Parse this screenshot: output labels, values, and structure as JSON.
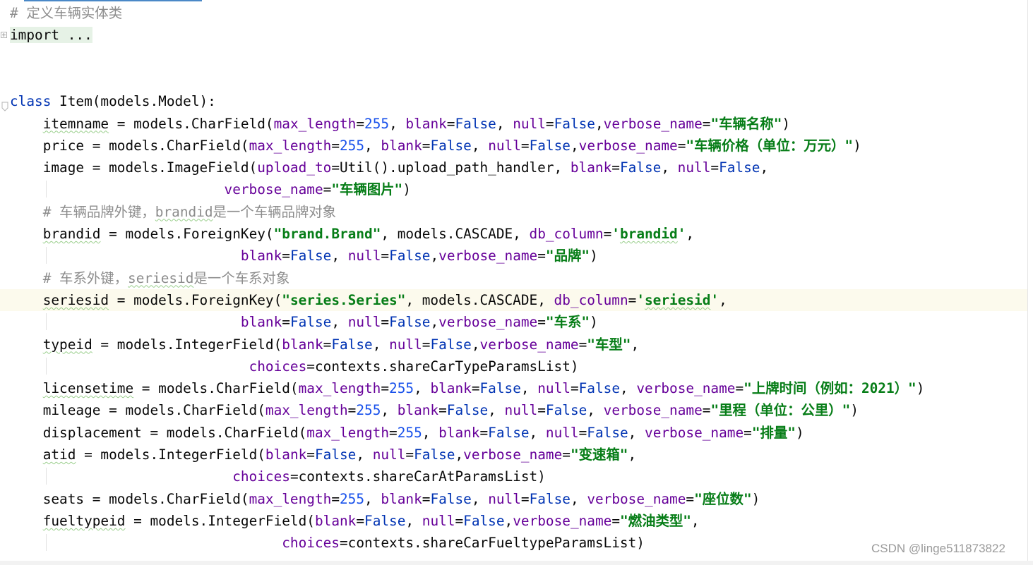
{
  "editor": {
    "lines": [
      {
        "tokens": [
          {
            "t": "# 定义车辆实体类",
            "c": "cm"
          }
        ]
      },
      {
        "fold": "collapsed",
        "tokens": [
          {
            "t": "import ...",
            "c": "folded"
          }
        ]
      },
      {
        "tokens": []
      },
      {
        "tokens": []
      },
      {
        "fold": "end",
        "tokens": [
          {
            "t": "class",
            "c": "kw"
          },
          {
            "t": " Item(models.Model):",
            "c": "id"
          }
        ]
      },
      {
        "tokens": [
          {
            "t": "    "
          },
          {
            "t": "itemname",
            "c": "id",
            "sq": true
          },
          {
            "t": " = models.CharField(",
            "c": "id"
          },
          {
            "t": "max_length",
            "c": "kwarg"
          },
          {
            "t": "=",
            "c": "id"
          },
          {
            "t": "255",
            "c": "num"
          },
          {
            "t": ", ",
            "c": "id"
          },
          {
            "t": "blank",
            "c": "kwarg"
          },
          {
            "t": "=",
            "c": "id"
          },
          {
            "t": "False",
            "c": "kw"
          },
          {
            "t": ", ",
            "c": "id"
          },
          {
            "t": "null",
            "c": "kwarg"
          },
          {
            "t": "=",
            "c": "id"
          },
          {
            "t": "False",
            "c": "kw"
          },
          {
            "t": ",",
            "c": "id"
          },
          {
            "t": "verbose_name",
            "c": "kwarg"
          },
          {
            "t": "=",
            "c": "id"
          },
          {
            "t": "\"车辆名称\"",
            "c": "str"
          },
          {
            "t": ")",
            "c": "id"
          }
        ]
      },
      {
        "tokens": [
          {
            "t": "    price = models.CharField(",
            "c": "id"
          },
          {
            "t": "max_length",
            "c": "kwarg"
          },
          {
            "t": "=",
            "c": "id"
          },
          {
            "t": "255",
            "c": "num"
          },
          {
            "t": ", ",
            "c": "id"
          },
          {
            "t": "blank",
            "c": "kwarg"
          },
          {
            "t": "=",
            "c": "id"
          },
          {
            "t": "False",
            "c": "kw"
          },
          {
            "t": ", ",
            "c": "id"
          },
          {
            "t": "null",
            "c": "kwarg"
          },
          {
            "t": "=",
            "c": "id"
          },
          {
            "t": "False",
            "c": "kw"
          },
          {
            "t": ",",
            "c": "id"
          },
          {
            "t": "verbose_name",
            "c": "kwarg"
          },
          {
            "t": "=",
            "c": "id"
          },
          {
            "t": "\"车辆价格（单位：万元）\"",
            "c": "str"
          },
          {
            "t": ")",
            "c": "id"
          }
        ]
      },
      {
        "tokens": [
          {
            "t": "    image = models.ImageField(",
            "c": "id"
          },
          {
            "t": "upload_to",
            "c": "kwarg"
          },
          {
            "t": "=Util().upload_path_handler, ",
            "c": "id"
          },
          {
            "t": "blank",
            "c": "kwarg"
          },
          {
            "t": "=",
            "c": "id"
          },
          {
            "t": "False",
            "c": "kw"
          },
          {
            "t": ", ",
            "c": "id"
          },
          {
            "t": "null",
            "c": "kwarg"
          },
          {
            "t": "=",
            "c": "id"
          },
          {
            "t": "False",
            "c": "kw"
          },
          {
            "t": ",",
            "c": "id"
          }
        ]
      },
      {
        "guide": true,
        "tokens": [
          {
            "t": "                          "
          },
          {
            "t": "verbose_name",
            "c": "kwarg"
          },
          {
            "t": "=",
            "c": "id"
          },
          {
            "t": "\"车辆图片\"",
            "c": "str"
          },
          {
            "t": ")",
            "c": "id"
          }
        ]
      },
      {
        "tokens": [
          {
            "t": "    "
          },
          {
            "t": "# 车辆品牌外键，",
            "c": "cm"
          },
          {
            "t": "brandid",
            "c": "cm",
            "sq": true
          },
          {
            "t": "是一个车辆品牌对象",
            "c": "cm"
          }
        ]
      },
      {
        "tokens": [
          {
            "t": "    "
          },
          {
            "t": "brandid",
            "c": "id",
            "sq": true
          },
          {
            "t": " = models.ForeignKey(",
            "c": "id"
          },
          {
            "t": "\"brand.Brand\"",
            "c": "str"
          },
          {
            "t": ", models.CASCADE, ",
            "c": "id"
          },
          {
            "t": "db_column",
            "c": "kwarg"
          },
          {
            "t": "=",
            "c": "id"
          },
          {
            "t": "'",
            "c": "str"
          },
          {
            "t": "brandid",
            "c": "str",
            "sq": true
          },
          {
            "t": "'",
            "c": "str"
          },
          {
            "t": ",",
            "c": "id"
          }
        ]
      },
      {
        "guide": true,
        "tokens": [
          {
            "t": "                            "
          },
          {
            "t": "blank",
            "c": "kwarg"
          },
          {
            "t": "=",
            "c": "id"
          },
          {
            "t": "False",
            "c": "kw"
          },
          {
            "t": ", ",
            "c": "id"
          },
          {
            "t": "null",
            "c": "kwarg"
          },
          {
            "t": "=",
            "c": "id"
          },
          {
            "t": "False",
            "c": "kw"
          },
          {
            "t": ",",
            "c": "id"
          },
          {
            "t": "verbose_name",
            "c": "kwarg"
          },
          {
            "t": "=",
            "c": "id"
          },
          {
            "t": "\"品牌\"",
            "c": "str"
          },
          {
            "t": ")",
            "c": "id"
          }
        ]
      },
      {
        "tokens": [
          {
            "t": "    "
          },
          {
            "t": "# 车系外键，",
            "c": "cm"
          },
          {
            "t": "seriesid",
            "c": "cm",
            "sq": true
          },
          {
            "t": "是一个车系对象",
            "c": "cm"
          }
        ]
      },
      {
        "current": true,
        "tokens": [
          {
            "t": "    "
          },
          {
            "t": "seriesid",
            "c": "id",
            "sq": true
          },
          {
            "t": " = models.ForeignKey(",
            "c": "id"
          },
          {
            "t": "\"series.Series\"",
            "c": "str"
          },
          {
            "t": ", models.CASCADE, ",
            "c": "id"
          },
          {
            "t": "db_column",
            "c": "kwarg"
          },
          {
            "t": "=",
            "c": "id"
          },
          {
            "t": "'",
            "c": "str"
          },
          {
            "t": "seriesid",
            "c": "str",
            "sq": true
          },
          {
            "t": "'",
            "c": "str"
          },
          {
            "t": ",",
            "c": "id"
          }
        ]
      },
      {
        "guide": true,
        "tokens": [
          {
            "t": "                            "
          },
          {
            "t": "blank",
            "c": "kwarg"
          },
          {
            "t": "=",
            "c": "id"
          },
          {
            "t": "False",
            "c": "kw"
          },
          {
            "t": ", ",
            "c": "id"
          },
          {
            "t": "null",
            "c": "kwarg"
          },
          {
            "t": "=",
            "c": "id"
          },
          {
            "t": "False",
            "c": "kw"
          },
          {
            "t": ",",
            "c": "id"
          },
          {
            "t": "verbose_name",
            "c": "kwarg"
          },
          {
            "t": "=",
            "c": "id"
          },
          {
            "t": "\"车系\"",
            "c": "str"
          },
          {
            "t": ")",
            "c": "id"
          }
        ]
      },
      {
        "tokens": [
          {
            "t": "    "
          },
          {
            "t": "typeid",
            "c": "id",
            "sq": true
          },
          {
            "t": " = models.IntegerField(",
            "c": "id"
          },
          {
            "t": "blank",
            "c": "kwarg"
          },
          {
            "t": "=",
            "c": "id"
          },
          {
            "t": "False",
            "c": "kw"
          },
          {
            "t": ", ",
            "c": "id"
          },
          {
            "t": "null",
            "c": "kwarg"
          },
          {
            "t": "=",
            "c": "id"
          },
          {
            "t": "False",
            "c": "kw"
          },
          {
            "t": ",",
            "c": "id"
          },
          {
            "t": "verbose_name",
            "c": "kwarg"
          },
          {
            "t": "=",
            "c": "id"
          },
          {
            "t": "\"车型\"",
            "c": "str"
          },
          {
            "t": ",",
            "c": "id"
          }
        ]
      },
      {
        "guide": true,
        "tokens": [
          {
            "t": "                             "
          },
          {
            "t": "choices",
            "c": "kwarg"
          },
          {
            "t": "=contexts.shareCarTypeParamsList)",
            "c": "id"
          }
        ]
      },
      {
        "tokens": [
          {
            "t": "    "
          },
          {
            "t": "licensetime",
            "c": "id",
            "sq": true
          },
          {
            "t": " = models.CharField(",
            "c": "id"
          },
          {
            "t": "max_length",
            "c": "kwarg"
          },
          {
            "t": "=",
            "c": "id"
          },
          {
            "t": "255",
            "c": "num"
          },
          {
            "t": ", ",
            "c": "id"
          },
          {
            "t": "blank",
            "c": "kwarg"
          },
          {
            "t": "=",
            "c": "id"
          },
          {
            "t": "False",
            "c": "kw"
          },
          {
            "t": ", ",
            "c": "id"
          },
          {
            "t": "null",
            "c": "kwarg"
          },
          {
            "t": "=",
            "c": "id"
          },
          {
            "t": "False",
            "c": "kw"
          },
          {
            "t": ", ",
            "c": "id"
          },
          {
            "t": "verbose_name",
            "c": "kwarg"
          },
          {
            "t": "=",
            "c": "id"
          },
          {
            "t": "\"上牌时间（例如：2021）\"",
            "c": "str"
          },
          {
            "t": ")",
            "c": "id"
          }
        ]
      },
      {
        "tokens": [
          {
            "t": "    mileage = models.CharField(",
            "c": "id"
          },
          {
            "t": "max_length",
            "c": "kwarg"
          },
          {
            "t": "=",
            "c": "id"
          },
          {
            "t": "255",
            "c": "num"
          },
          {
            "t": ", ",
            "c": "id"
          },
          {
            "t": "blank",
            "c": "kwarg"
          },
          {
            "t": "=",
            "c": "id"
          },
          {
            "t": "False",
            "c": "kw"
          },
          {
            "t": ", ",
            "c": "id"
          },
          {
            "t": "null",
            "c": "kwarg"
          },
          {
            "t": "=",
            "c": "id"
          },
          {
            "t": "False",
            "c": "kw"
          },
          {
            "t": ", ",
            "c": "id"
          },
          {
            "t": "verbose_name",
            "c": "kwarg"
          },
          {
            "t": "=",
            "c": "id"
          },
          {
            "t": "\"里程（单位：公里）\"",
            "c": "str"
          },
          {
            "t": ")",
            "c": "id"
          }
        ]
      },
      {
        "tokens": [
          {
            "t": "    displacement = models.CharField(",
            "c": "id"
          },
          {
            "t": "max_length",
            "c": "kwarg"
          },
          {
            "t": "=",
            "c": "id"
          },
          {
            "t": "255",
            "c": "num"
          },
          {
            "t": ", ",
            "c": "id"
          },
          {
            "t": "blank",
            "c": "kwarg"
          },
          {
            "t": "=",
            "c": "id"
          },
          {
            "t": "False",
            "c": "kw"
          },
          {
            "t": ", ",
            "c": "id"
          },
          {
            "t": "null",
            "c": "kwarg"
          },
          {
            "t": "=",
            "c": "id"
          },
          {
            "t": "False",
            "c": "kw"
          },
          {
            "t": ", ",
            "c": "id"
          },
          {
            "t": "verbose_name",
            "c": "kwarg"
          },
          {
            "t": "=",
            "c": "id"
          },
          {
            "t": "\"排量\"",
            "c": "str"
          },
          {
            "t": ")",
            "c": "id"
          }
        ]
      },
      {
        "tokens": [
          {
            "t": "    "
          },
          {
            "t": "atid",
            "c": "id",
            "sq": true
          },
          {
            "t": " = models.IntegerField(",
            "c": "id"
          },
          {
            "t": "blank",
            "c": "kwarg"
          },
          {
            "t": "=",
            "c": "id"
          },
          {
            "t": "False",
            "c": "kw"
          },
          {
            "t": ", ",
            "c": "id"
          },
          {
            "t": "null",
            "c": "kwarg"
          },
          {
            "t": "=",
            "c": "id"
          },
          {
            "t": "False",
            "c": "kw"
          },
          {
            "t": ",",
            "c": "id"
          },
          {
            "t": "verbose_name",
            "c": "kwarg"
          },
          {
            "t": "=",
            "c": "id"
          },
          {
            "t": "\"变速箱\"",
            "c": "str"
          },
          {
            "t": ",",
            "c": "id"
          }
        ]
      },
      {
        "guide": true,
        "tokens": [
          {
            "t": "                           "
          },
          {
            "t": "choices",
            "c": "kwarg"
          },
          {
            "t": "=contexts.shareCarAtParamsList)",
            "c": "id"
          }
        ]
      },
      {
        "tokens": [
          {
            "t": "    seats = models.CharField(",
            "c": "id"
          },
          {
            "t": "max_length",
            "c": "kwarg"
          },
          {
            "t": "=",
            "c": "id"
          },
          {
            "t": "255",
            "c": "num"
          },
          {
            "t": ", ",
            "c": "id"
          },
          {
            "t": "blank",
            "c": "kwarg"
          },
          {
            "t": "=",
            "c": "id"
          },
          {
            "t": "False",
            "c": "kw"
          },
          {
            "t": ", ",
            "c": "id"
          },
          {
            "t": "null",
            "c": "kwarg"
          },
          {
            "t": "=",
            "c": "id"
          },
          {
            "t": "False",
            "c": "kw"
          },
          {
            "t": ", ",
            "c": "id"
          },
          {
            "t": "verbose_name",
            "c": "kwarg"
          },
          {
            "t": "=",
            "c": "id"
          },
          {
            "t": "\"座位数\"",
            "c": "str"
          },
          {
            "t": ")",
            "c": "id"
          }
        ]
      },
      {
        "tokens": [
          {
            "t": "    "
          },
          {
            "t": "fueltypeid",
            "c": "id",
            "sq": true
          },
          {
            "t": " = models.IntegerField(",
            "c": "id"
          },
          {
            "t": "blank",
            "c": "kwarg"
          },
          {
            "t": "=",
            "c": "id"
          },
          {
            "t": "False",
            "c": "kw"
          },
          {
            "t": ", ",
            "c": "id"
          },
          {
            "t": "null",
            "c": "kwarg"
          },
          {
            "t": "=",
            "c": "id"
          },
          {
            "t": "False",
            "c": "kw"
          },
          {
            "t": ",",
            "c": "id"
          },
          {
            "t": "verbose_name",
            "c": "kwarg"
          },
          {
            "t": "=",
            "c": "id"
          },
          {
            "t": "\"燃油类型\"",
            "c": "str"
          },
          {
            "t": ",",
            "c": "id"
          }
        ]
      },
      {
        "guide": true,
        "tokens": [
          {
            "t": "                                 "
          },
          {
            "t": "choices",
            "c": "kwarg"
          },
          {
            "t": "=contexts.shareCarFueltypeParamsList)",
            "c": "id"
          }
        ]
      }
    ]
  },
  "watermark": "CSDN @linge511873822",
  "colors": {
    "keyword": "#0033b3",
    "kwarg": "#660099",
    "number": "#1750eb",
    "string": "#067d17",
    "comment": "#8c8c8c",
    "current_line": "#fcfaed",
    "folded_bg": "#e6f2e6"
  }
}
